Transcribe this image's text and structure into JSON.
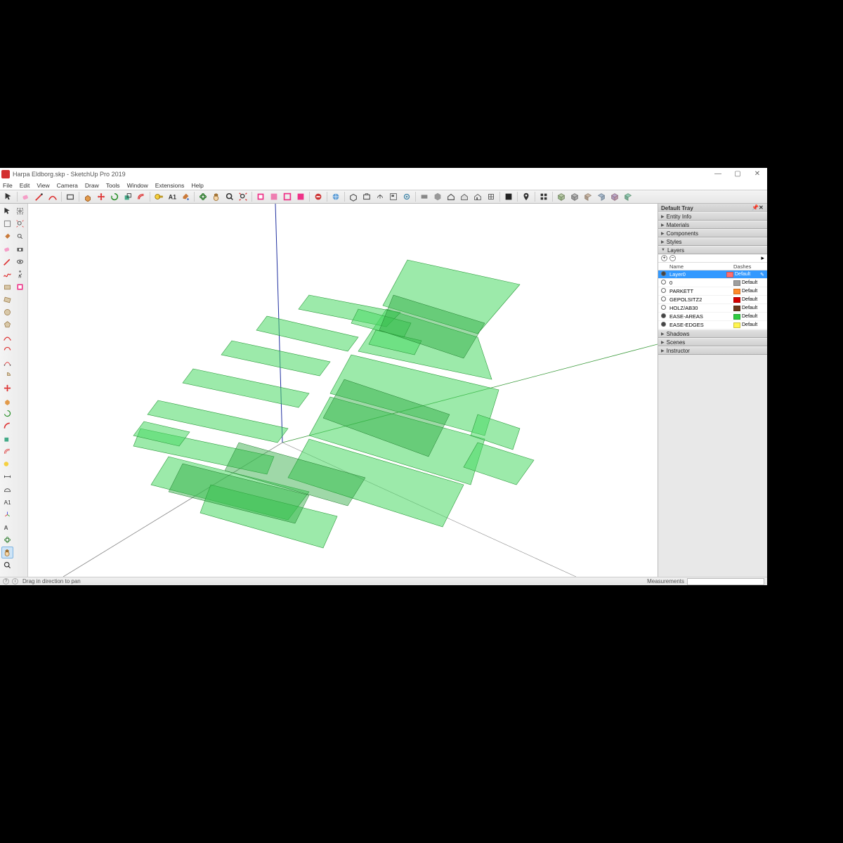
{
  "window": {
    "title": "Harpa Eldborg.skp - SketchUp Pro 2019",
    "minimize": "—",
    "maximize": "▢",
    "close": "✕"
  },
  "menu": [
    "File",
    "Edit",
    "View",
    "Camera",
    "Draw",
    "Tools",
    "Window",
    "Extensions",
    "Help"
  ],
  "tray": {
    "title": "Default Tray",
    "pin": "📌",
    "close": "✕",
    "panels_closed_top": [
      "Entity Info",
      "Materials",
      "Components",
      "Styles"
    ],
    "layers_label": "Layers",
    "panels_closed_bottom": [
      "Shadows",
      "Scenes",
      "Instructor"
    ],
    "layers_header": {
      "name": "Name",
      "dashes": "Dashes"
    }
  },
  "layers": [
    {
      "vis": "on",
      "name": "Layer0",
      "color": "#ff6e6e",
      "dash": "Default",
      "selected": true,
      "pen": "✎"
    },
    {
      "vis": "off",
      "name": "0",
      "color": "#9e9e9e",
      "dash": "Default"
    },
    {
      "vis": "off",
      "name": "PARKETT",
      "color": "#ff8a2a",
      "dash": "Default"
    },
    {
      "vis": "off",
      "name": "GEPOLSITZ2",
      "color": "#d40000",
      "dash": "Default"
    },
    {
      "vis": "off",
      "name": "HOLZ/AB30",
      "color": "#6b3b1f",
      "dash": "Default"
    },
    {
      "vis": "on",
      "name": "EASE-AREAS",
      "color": "#2ecc40",
      "dash": "Default"
    },
    {
      "vis": "on",
      "name": "EASE-EDGES",
      "color": "#fff44f",
      "dash": "Default"
    }
  ],
  "status": {
    "hint": "Drag in direction to pan",
    "measurements_label": "Measurements"
  }
}
